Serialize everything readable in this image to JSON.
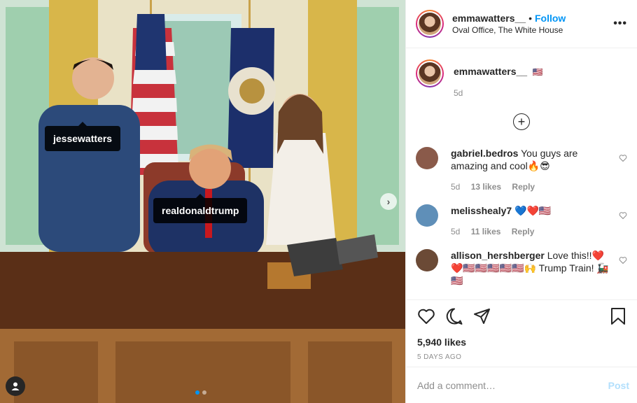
{
  "photo": {
    "tags": [
      "jessewatters",
      "realdonaldtrump"
    ],
    "carousel_pages": 2,
    "carousel_active": 1,
    "icons": {
      "next": "chevron-right-icon",
      "user_tags": "user-icon"
    }
  },
  "header": {
    "username": "emmawatters__",
    "separator": "•",
    "follow_label": "Follow",
    "location": "Oval Office, The White House",
    "more_icon": "more-horizontal-icon"
  },
  "caption": {
    "username": "emmawatters__",
    "emoji": "🇺🇸",
    "time": "5d"
  },
  "load_more_icon": "plus-circle-icon",
  "comments": [
    {
      "username": "gabriel.bedros",
      "text": "You guys are amazing and cool🔥😎",
      "time": "5d",
      "likes": "13 likes",
      "reply": "Reply",
      "avatar_color": "#8a5a4a"
    },
    {
      "username": "melisshealy7",
      "text": "💙❤️🇺🇸",
      "time": "5d",
      "likes": "11 likes",
      "reply": "Reply",
      "avatar_color": "#5f8fb8"
    },
    {
      "username": "allison_hershberger",
      "text": "Love this!!❤️ ❤️🇺🇸🇺🇸🇺🇸🇺🇸🇺🇸🙌 Trump Train! 🚂🇺🇸",
      "time": "",
      "likes": "",
      "reply": "",
      "avatar_color": "#6b4a36"
    }
  ],
  "actions": {
    "icons": [
      "heart-icon",
      "comment-icon",
      "share-icon",
      "bookmark-icon"
    ],
    "likes": "5,940 likes",
    "ago": "5 DAYS AGO"
  },
  "add_comment": {
    "placeholder": "Add a comment…",
    "post_label": "Post"
  },
  "colors": {
    "accent": "#0095f6",
    "post_disabled": "#b2dffc",
    "muted": "#8e8e8e"
  }
}
